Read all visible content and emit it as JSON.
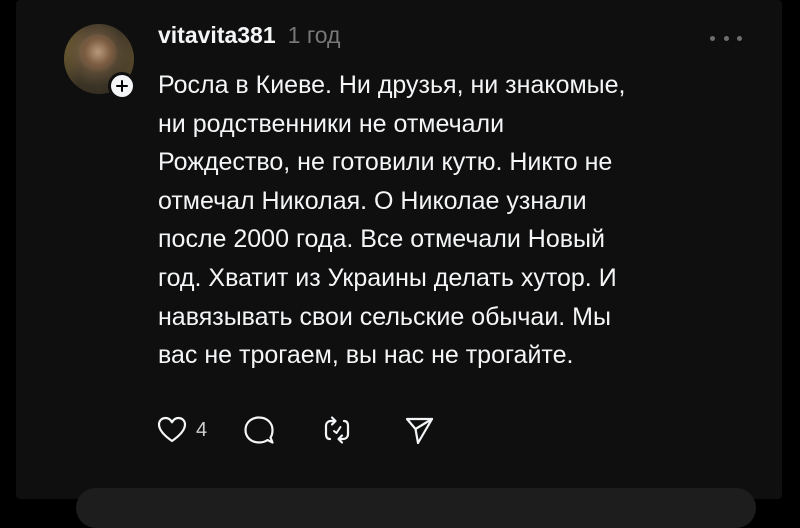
{
  "post": {
    "username": "vitavita381",
    "time": "1 год",
    "text": "Росла в Киеве. Ни друзья, ни знакомые,\nни родственники не отмечали\nРождество, не готовили кутю. Никто не\nотмечал Николая. О Николае узнали\nпосле 2000 года. Все отмечали Новый\nгод. Хватит из Украины делать хутор. И\nнавязывать свои сельские обычаи. Мы\nвас не трогаем, вы нас не трогайте.",
    "likes": "4"
  },
  "icons": {
    "more": "more-horizontal-icon",
    "follow": "plus-icon",
    "like": "heart-icon",
    "reply": "comment-bubble-icon",
    "repost": "repost-icon",
    "share": "send-icon"
  },
  "colors": {
    "background": "#000000",
    "panel": "#0f0f0f",
    "text": "#f3f5f7",
    "muted": "#777777"
  }
}
